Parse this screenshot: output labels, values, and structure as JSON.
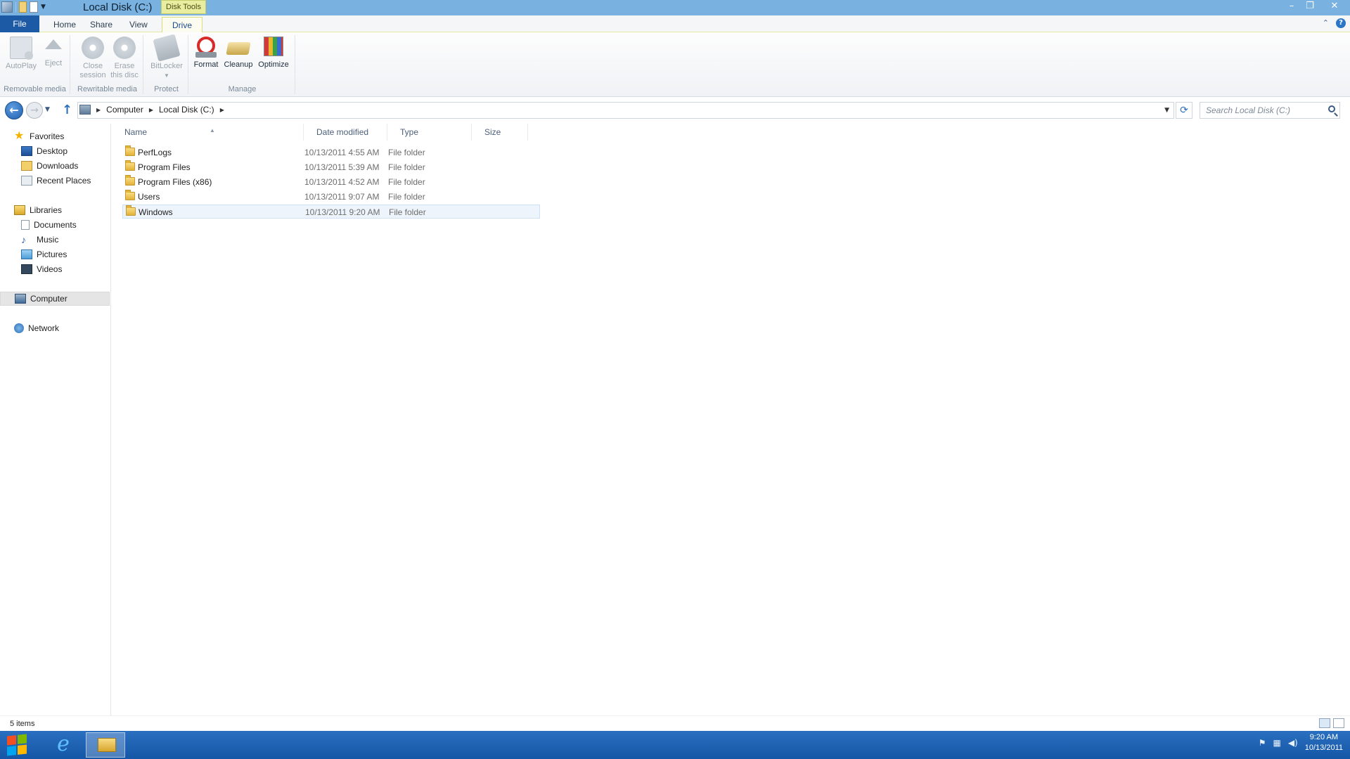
{
  "window": {
    "title": "Local Disk (C:)",
    "context_tab_group": "Disk Tools"
  },
  "ribbon": {
    "tabs": [
      {
        "label": "File"
      },
      {
        "label": "Home"
      },
      {
        "label": "Share"
      },
      {
        "label": "View"
      },
      {
        "label": "Drive"
      }
    ],
    "active_tab": "Drive",
    "groups": {
      "removable_media": {
        "label": "Removable media",
        "autoplay": "AutoPlay",
        "eject": "Eject"
      },
      "rewritable_media": {
        "label": "Rewritable media",
        "close_session_1": "Close",
        "close_session_2": "session",
        "erase_1": "Erase",
        "erase_2": "this disc"
      },
      "protect": {
        "label": "Protect",
        "bitlocker": "BitLocker"
      },
      "manage": {
        "label": "Manage",
        "format": "Format",
        "cleanup": "Cleanup",
        "optimize": "Optimize"
      }
    }
  },
  "address_bar": {
    "crumbs": [
      "Computer",
      "Local Disk (C:)"
    ],
    "search_placeholder": "Search Local Disk (C:)"
  },
  "nav_pane": {
    "favorites": {
      "label": "Favorites",
      "items": [
        "Desktop",
        "Downloads",
        "Recent Places"
      ]
    },
    "libraries": {
      "label": "Libraries",
      "items": [
        "Documents",
        "Music",
        "Pictures",
        "Videos"
      ]
    },
    "computer": "Computer",
    "network": "Network"
  },
  "file_list": {
    "columns": [
      "Name",
      "Date modified",
      "Type",
      "Size"
    ],
    "rows": [
      {
        "name": "PerfLogs",
        "date": "10/13/2011 4:55 AM",
        "type": "File folder"
      },
      {
        "name": "Program Files",
        "date": "10/13/2011 5:39 AM",
        "type": "File folder"
      },
      {
        "name": "Program Files (x86)",
        "date": "10/13/2011 4:52 AM",
        "type": "File folder"
      },
      {
        "name": "Users",
        "date": "10/13/2011 9:07 AM",
        "type": "File folder"
      },
      {
        "name": "Windows",
        "date": "10/13/2011 9:20 AM",
        "type": "File folder"
      }
    ],
    "selected_row": "Windows"
  },
  "status_bar": {
    "item_count": "5 items"
  },
  "taskbar": {
    "time": "9:20 AM",
    "date": "10/13/2011"
  },
  "colors": {
    "titlebar": "#79b1e0",
    "file_tab": "#1c5aa6",
    "taskbar": "#1d60b0",
    "context_tab": "#e9ed9f"
  }
}
